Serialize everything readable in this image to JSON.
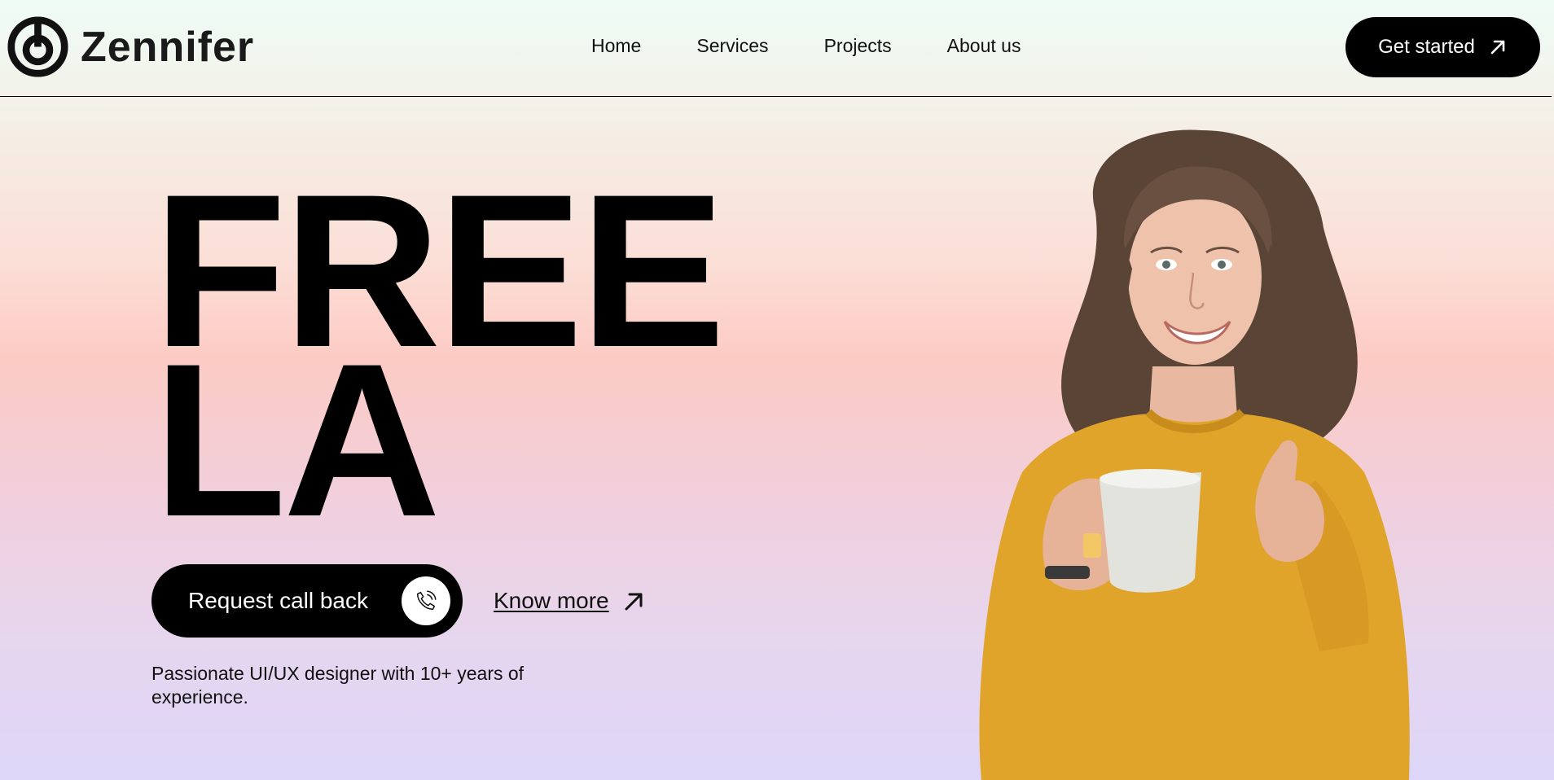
{
  "brand": {
    "name": "Zennifer",
    "logo_icon": "power-ring-icon"
  },
  "nav": {
    "items": [
      {
        "label": "Home"
      },
      {
        "label": "Services"
      },
      {
        "label": "Projects"
      },
      {
        "label": "About us"
      }
    ]
  },
  "header_cta": {
    "label": "Get started",
    "icon": "arrow-up-right-icon"
  },
  "hero": {
    "title_line1": "FREE",
    "title_line2": "LA",
    "primary_button": {
      "label": "Request call back",
      "icon": "phone-call-icon"
    },
    "secondary_link": {
      "label": "Know more",
      "icon": "arrow-up-right-icon"
    },
    "tagline": "Passionate UI/UX designer with 10+ years of experience.",
    "image_subject": "woman-holding-mug-thumbs-up"
  },
  "colors": {
    "primary": "#000000",
    "button_text": "#ffffff",
    "sweater": "#e0a42a",
    "gradient_top": "#eefcf6",
    "gradient_mid": "#fccbc4",
    "gradient_bottom": "#ddd6f8"
  }
}
